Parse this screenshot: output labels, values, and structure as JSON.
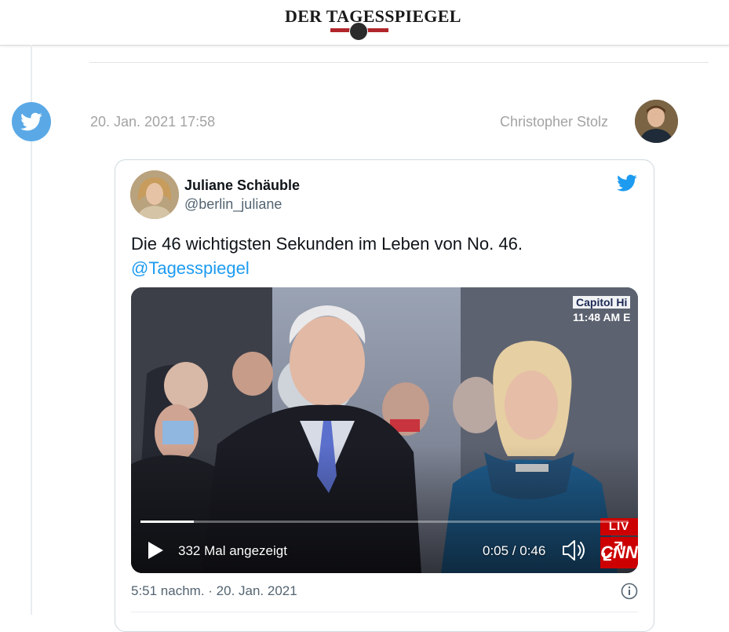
{
  "header": {
    "logo_text": "DER TAGESSPIEGEL"
  },
  "post": {
    "date": "20. Jan. 2021 17:58",
    "author": "Christopher Stolz",
    "source_icon": "twitter-bird-icon"
  },
  "tweet": {
    "name": "Juliane Schäuble",
    "handle": "@berlin_juliane",
    "text": "Die 46 wichtigsten Sekunden im Leben von No. 46.",
    "mention": "@Tagesspiegel",
    "timestamp": "5:51 nachm. · 20. Jan. 2021"
  },
  "video": {
    "overlay_line1": "Capitol Hi",
    "overlay_line2": "11:48 AM E",
    "live_label": "LIV",
    "network_logo": "CNN",
    "views": "332 Mal angezeigt",
    "time": "0:05 / 0:46",
    "progress": 0.109
  },
  "colors": {
    "twitter_blue": "#1d9bf0",
    "badge_blue": "#5aa9e6",
    "brand_red": "#b0262a",
    "cnn_red": "#cc0000"
  }
}
